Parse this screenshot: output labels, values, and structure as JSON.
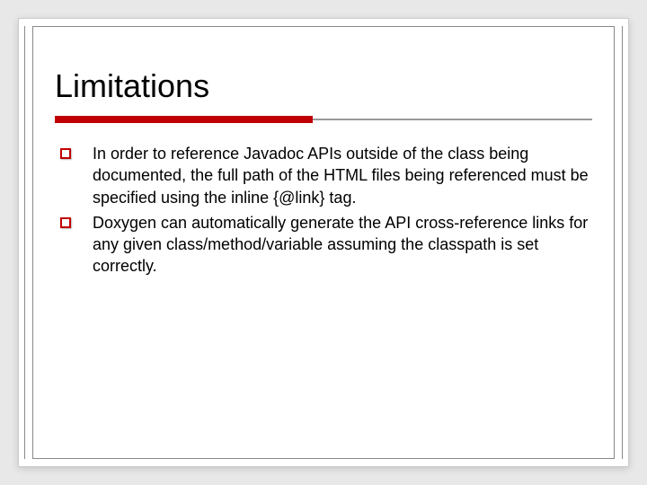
{
  "slide": {
    "title": "Limitations",
    "bullets": [
      {
        "text": "In order to reference Javadoc APIs outside of the class being documented, the full path of the HTML files being referenced must be specified using the inline {@link} tag."
      },
      {
        "text": "Doxygen can automatically generate the API cross-reference links for any given class/method/variable assuming the classpath is set correctly."
      }
    ],
    "accent_color": "#c00000"
  }
}
